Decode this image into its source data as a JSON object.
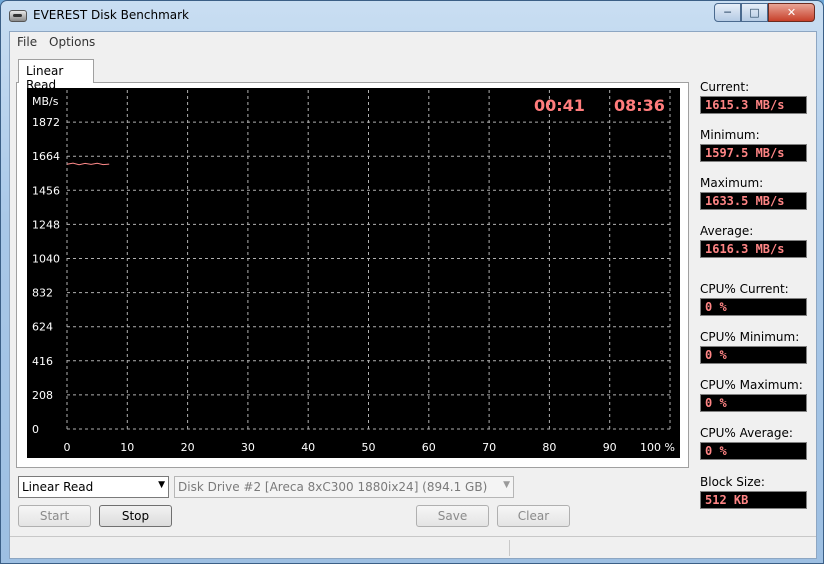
{
  "window": {
    "title": "EVEREST Disk Benchmark",
    "minimize": "─",
    "maximize": "□",
    "close": "✕"
  },
  "menu": {
    "file": "File",
    "options": "Options"
  },
  "tab": {
    "label": "Linear Read"
  },
  "graph": {
    "unit": "MB/s",
    "elapsed": "00:41",
    "remaining": "08:36",
    "y_ticks": [
      "1872",
      "1664",
      "1456",
      "1248",
      "1040",
      "832",
      "624",
      "416",
      "208",
      "0"
    ],
    "x_ticks": [
      "0",
      "10",
      "20",
      "30",
      "40",
      "50",
      "60",
      "70",
      "80",
      "90",
      "100 %"
    ],
    "line_color": "#ff8a8a",
    "grid_color": "#b0b0b0"
  },
  "chart_data": {
    "type": "line",
    "xlabel": "",
    "ylabel": "MB/s",
    "xlim": [
      0,
      100
    ],
    "ylim": [
      0,
      2080
    ],
    "grid": true,
    "series": [
      {
        "x": [
          0,
          1,
          2,
          3,
          4,
          5,
          6,
          7
        ],
        "values": [
          1615,
          1622,
          1612,
          1620,
          1614,
          1621,
          1613,
          1616
        ]
      }
    ]
  },
  "stats": [
    {
      "label": "Current:",
      "value": "1615.3 MB/s"
    },
    {
      "label": "Minimum:",
      "value": "1597.5 MB/s"
    },
    {
      "label": "Maximum:",
      "value": "1633.5 MB/s"
    },
    {
      "label": "Average:",
      "value": "1616.3 MB/s"
    },
    {
      "label": "CPU% Current:",
      "value": "0 %"
    },
    {
      "label": "CPU% Minimum:",
      "value": "0 %"
    },
    {
      "label": "CPU% Maximum:",
      "value": "0 %"
    },
    {
      "label": "CPU% Average:",
      "value": "0 %"
    },
    {
      "label": "Block Size:",
      "value": "512 KB"
    }
  ],
  "controls": {
    "mode": "Linear Read",
    "drive": "Disk Drive #2  [Areca   8xC300 1880ix24]  (894.1 GB)",
    "start": "Start",
    "stop": "Stop",
    "save": "Save",
    "clear": "Clear"
  }
}
